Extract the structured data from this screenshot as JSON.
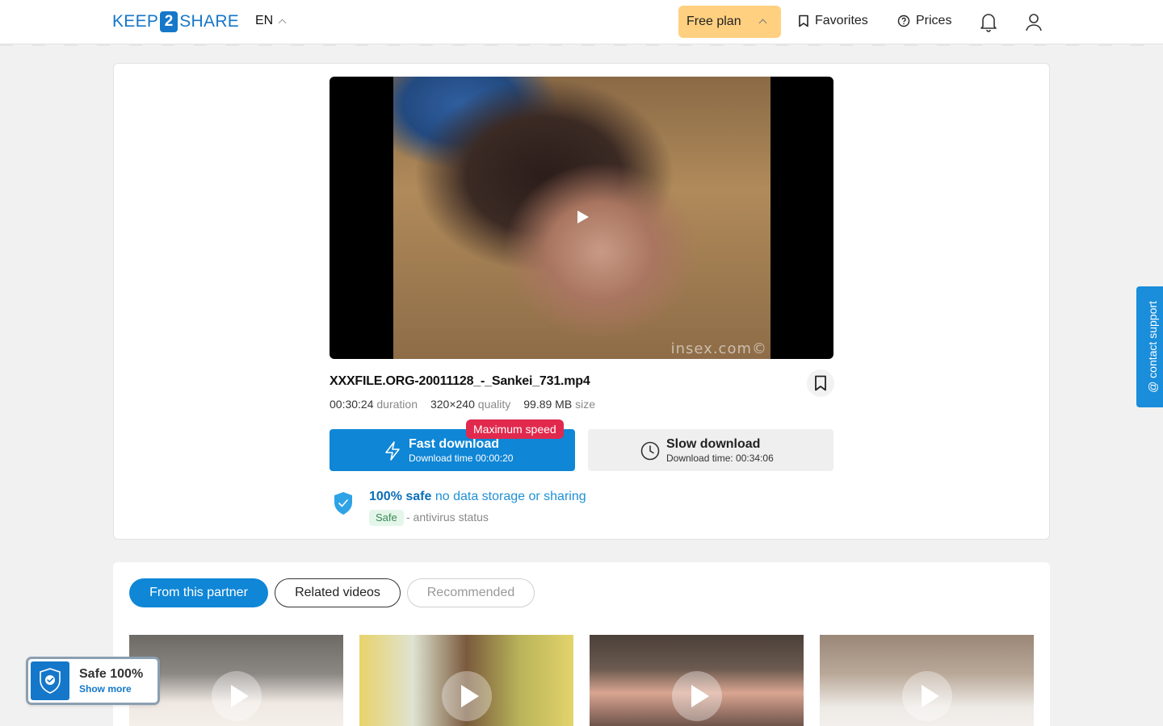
{
  "header": {
    "logo_left": "KEEP",
    "logo_num": "2",
    "logo_right": "SHARE",
    "lang": "EN",
    "plan": "Free plan",
    "favorites": "Favorites",
    "prices": "Prices"
  },
  "video": {
    "watermark": "insex.com©"
  },
  "file": {
    "name": "XXXFILE.ORG-20011128_-_Sankei_731.mp4",
    "duration_value": "00:30:24",
    "duration_label": "duration",
    "quality_value": "320×240",
    "quality_label": "quality",
    "size_value": "99.89 MB",
    "size_label": "size"
  },
  "download": {
    "badge": "Maximum speed",
    "fast_label": "Fast download",
    "fast_sub": "Download time 00:00:20",
    "slow_label": "Slow download",
    "slow_sub": "Download time: 00:34:06"
  },
  "safety": {
    "strong": "100% safe",
    "rest": "no data storage or sharing",
    "badge": "Safe",
    "av_status": "- antivirus status"
  },
  "support": {
    "label": "@ contact support"
  },
  "tabs": [
    {
      "label": "From this partner"
    },
    {
      "label": "Related videos"
    },
    {
      "label": "Recommended"
    }
  ],
  "safe_float": {
    "title": "Safe 100%",
    "link": "Show more"
  },
  "colors": {
    "accent": "#0f86d6",
    "plan": "#ffd080",
    "badge": "#e0294d"
  }
}
